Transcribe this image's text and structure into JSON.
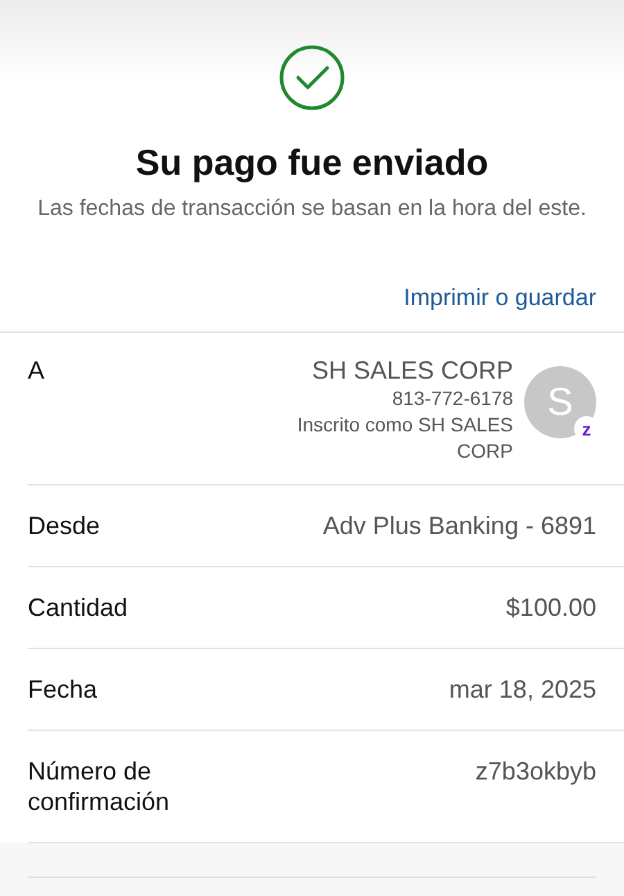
{
  "header": {
    "title": "Su pago fue enviado",
    "subtitle": "Las fechas de transacción se basan en la hora del este."
  },
  "print_link": "Imprimir o guardar",
  "details": [
    {
      "kind": "payee",
      "label": "A",
      "name": "SH SALES CORP",
      "phone": "813-772-6178",
      "enrolled": "Inscrito como SH SALES CORP",
      "avatar": "S",
      "badge": "z"
    },
    {
      "kind": "plain",
      "label": "Desde",
      "value": "Adv Plus Banking - 6891"
    },
    {
      "kind": "plain",
      "label": "Cantidad",
      "value": "$100.00"
    },
    {
      "kind": "plain",
      "label": "Fecha",
      "value": "mar 18, 2025"
    },
    {
      "kind": "plain",
      "label": "Número de confirmación",
      "value": "z7b3okbyb"
    }
  ]
}
